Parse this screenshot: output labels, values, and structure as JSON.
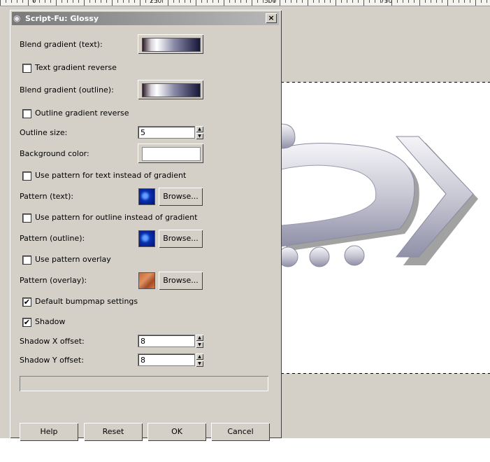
{
  "ruler": {
    "marks": [
      "0",
      "250",
      "500",
      "750"
    ]
  },
  "dialog": {
    "title": "Script-Fu: Glossy",
    "close_label": "×",
    "blend_text_label": "Blend gradient (text):",
    "text_reverse_label": "Text gradient reverse",
    "text_reverse_checked": false,
    "blend_outline_label": "Blend gradient (outline):",
    "outline_reverse_label": "Outline gradient reverse",
    "outline_reverse_checked": false,
    "outline_size_label": "Outline size:",
    "outline_size_value": "5",
    "bg_color_label": "Background color:",
    "bg_color_value": "#ffffff",
    "use_pattern_text_label": "Use pattern for text instead of gradient",
    "pattern_text_label": "Pattern (text):",
    "browse_label": "Browse...",
    "use_pattern_outline_label": "Use pattern for outline instead of gradient",
    "pattern_outline_label": "Pattern (outline):",
    "use_overlay_label": "Use pattern overlay",
    "pattern_overlay_label": "Pattern (overlay):",
    "bumpmap_label": "Default bumpmap settings",
    "bumpmap_checked": true,
    "shadow_label": "Shadow",
    "shadow_checked": true,
    "shadow_x_label": "Shadow X offset:",
    "shadow_x_value": "8",
    "shadow_y_label": "Shadow Y offset:",
    "shadow_y_value": "8",
    "check_mark": "✔",
    "buttons": {
      "help": "Help",
      "reset": "Reset",
      "ok": "OK",
      "cancel": "Cancel"
    }
  }
}
